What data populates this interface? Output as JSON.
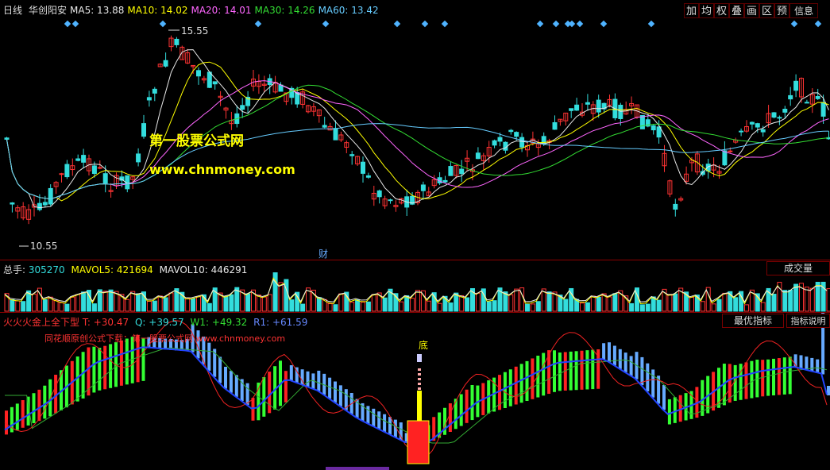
{
  "header": {
    "period": "日线",
    "stock_name": "华创阳安",
    "ma": [
      {
        "label": "MA5: ",
        "value": "13.88",
        "color": "#e8e8e8"
      },
      {
        "label": "MA10: ",
        "value": "14.02",
        "color": "#ffff00"
      },
      {
        "label": "MA20: ",
        "value": "14.01",
        "color": "#ff66ff"
      },
      {
        "label": "MA30: ",
        "value": "14.26",
        "color": "#33dd33"
      },
      {
        "label": "MA60: ",
        "value": "13.42",
        "color": "#66ccff"
      }
    ]
  },
  "toolbar": {
    "buttons": [
      "加",
      "均",
      "权",
      "叠",
      "画",
      "区",
      "预"
    ],
    "info": "信息"
  },
  "price_panel": {
    "high_label": "15.55",
    "low_label": "10.55",
    "fin_marker": "财",
    "watermark_title": "第一股票公式网",
    "watermark_url": "www.chnmoney.com"
  },
  "volume_panel": {
    "label": "总手: ",
    "value": "305270",
    "mavol5_label": "MAVOL5: ",
    "mavol5_value": "421694",
    "mavol10_label": "MAVOL10: ",
    "mavol10_value": "446291",
    "tab": "成交量"
  },
  "indicator_panel": {
    "name": "火火火金上全下型",
    "t_label": "T: ",
    "t_value": "+30.47",
    "q_label": "Q: ",
    "q_value": "+39.57",
    "w1_label": "W1: ",
    "w1_value": "+49.32",
    "r1_label": "R1: ",
    "r1_value": "+61.59",
    "tab_best": "最优指标",
    "tab_explain": "指标说明",
    "source_text": "同花顺原创公式下载：第一股票公式网 www.chnmoney.com",
    "bottom_marker": "底"
  },
  "colors": {
    "up": "#ff3333",
    "down": "#33dddd",
    "border": "#8a0000",
    "ma5": "#e8e8e8",
    "ma10": "#ffff00",
    "ma20": "#ff66ff",
    "ma30": "#33dd33",
    "ma60": "#66ccff",
    "ind_green": "#33ff33",
    "ind_red": "#ff2222",
    "ind_blue": "#66aaff",
    "ind_line": "#2244ff",
    "watermark": "#ffff00"
  }
}
